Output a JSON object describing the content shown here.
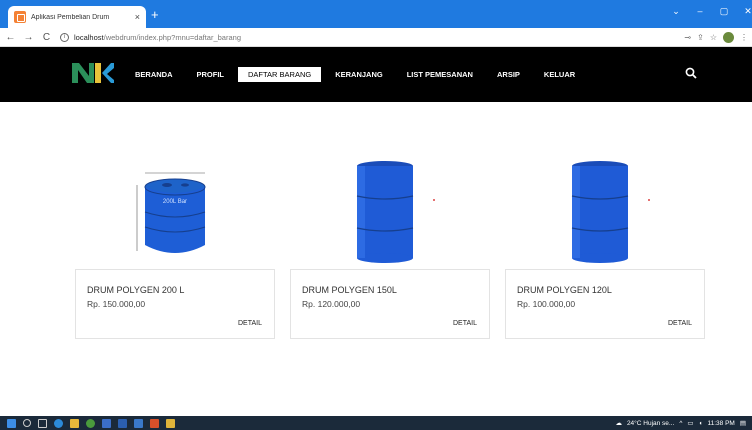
{
  "browser": {
    "tab_title": "Aplikasi Pembelian Drum",
    "tab_close": "×",
    "new_tab": "+",
    "url_host": "localhost",
    "url_path": "/webdrum/index.php?mnu=daftar_barang"
  },
  "nav": {
    "items": [
      {
        "label": "BERANDA"
      },
      {
        "label": "PROFIL"
      },
      {
        "label": "DAFTAR BARANG"
      },
      {
        "label": "KERANJANG"
      },
      {
        "label": "LIST PEMESANAN"
      },
      {
        "label": "ARSIP"
      },
      {
        "label": "KELUAR"
      }
    ],
    "active_index": 2
  },
  "products": [
    {
      "name": "DRUM POLYGEN 200 L",
      "price": "Rp. 150.000,00",
      "detail": "DETAIL",
      "image_label": "200L Bar"
    },
    {
      "name": "DRUM POLYGEN 150L",
      "price": "Rp. 120.000,00",
      "detail": "DETAIL"
    },
    {
      "name": "DRUM POLYGEN 120L",
      "price": "Rp. 100.000,00",
      "detail": "DETAIL"
    }
  ],
  "taskbar": {
    "weather": "24°C  Hujan se...",
    "time": "11:38 PM"
  },
  "colors": {
    "browser_blue": "#1f7ae0",
    "nav_bg": "#000000",
    "drum_blue": "#1f5bd6",
    "taskbar": "#1b2a3a"
  }
}
